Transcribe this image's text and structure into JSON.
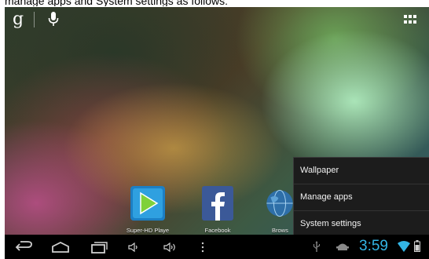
{
  "caption": "manage apps and System settings as follows:",
  "topbar": {
    "search_logo": "g",
    "icons": [
      "google-search-icon",
      "microphone-icon",
      "all-apps-grid-icon"
    ]
  },
  "dock": [
    {
      "label": "Super-HD Playe",
      "icon": "video-player-icon"
    },
    {
      "label": "Facebook",
      "icon": "facebook-icon"
    },
    {
      "label": "Brows",
      "icon": "browser-globe-icon"
    }
  ],
  "menu": {
    "items": [
      "Wallpaper",
      "Manage apps",
      "System settings"
    ]
  },
  "navbar": {
    "buttons": [
      "back-icon",
      "home-icon",
      "recent-apps-icon",
      "volume-down-icon",
      "volume-up-icon",
      "overflow-menu-icon"
    ],
    "status_icons": [
      "usb-icon",
      "android-debug-icon",
      "wifi-icon",
      "battery-icon"
    ],
    "time": "3:59"
  },
  "colors": {
    "accent_clock": "#33b5e5",
    "menu_bg": "#1c1c1c",
    "navbar_bg": "#000000"
  }
}
